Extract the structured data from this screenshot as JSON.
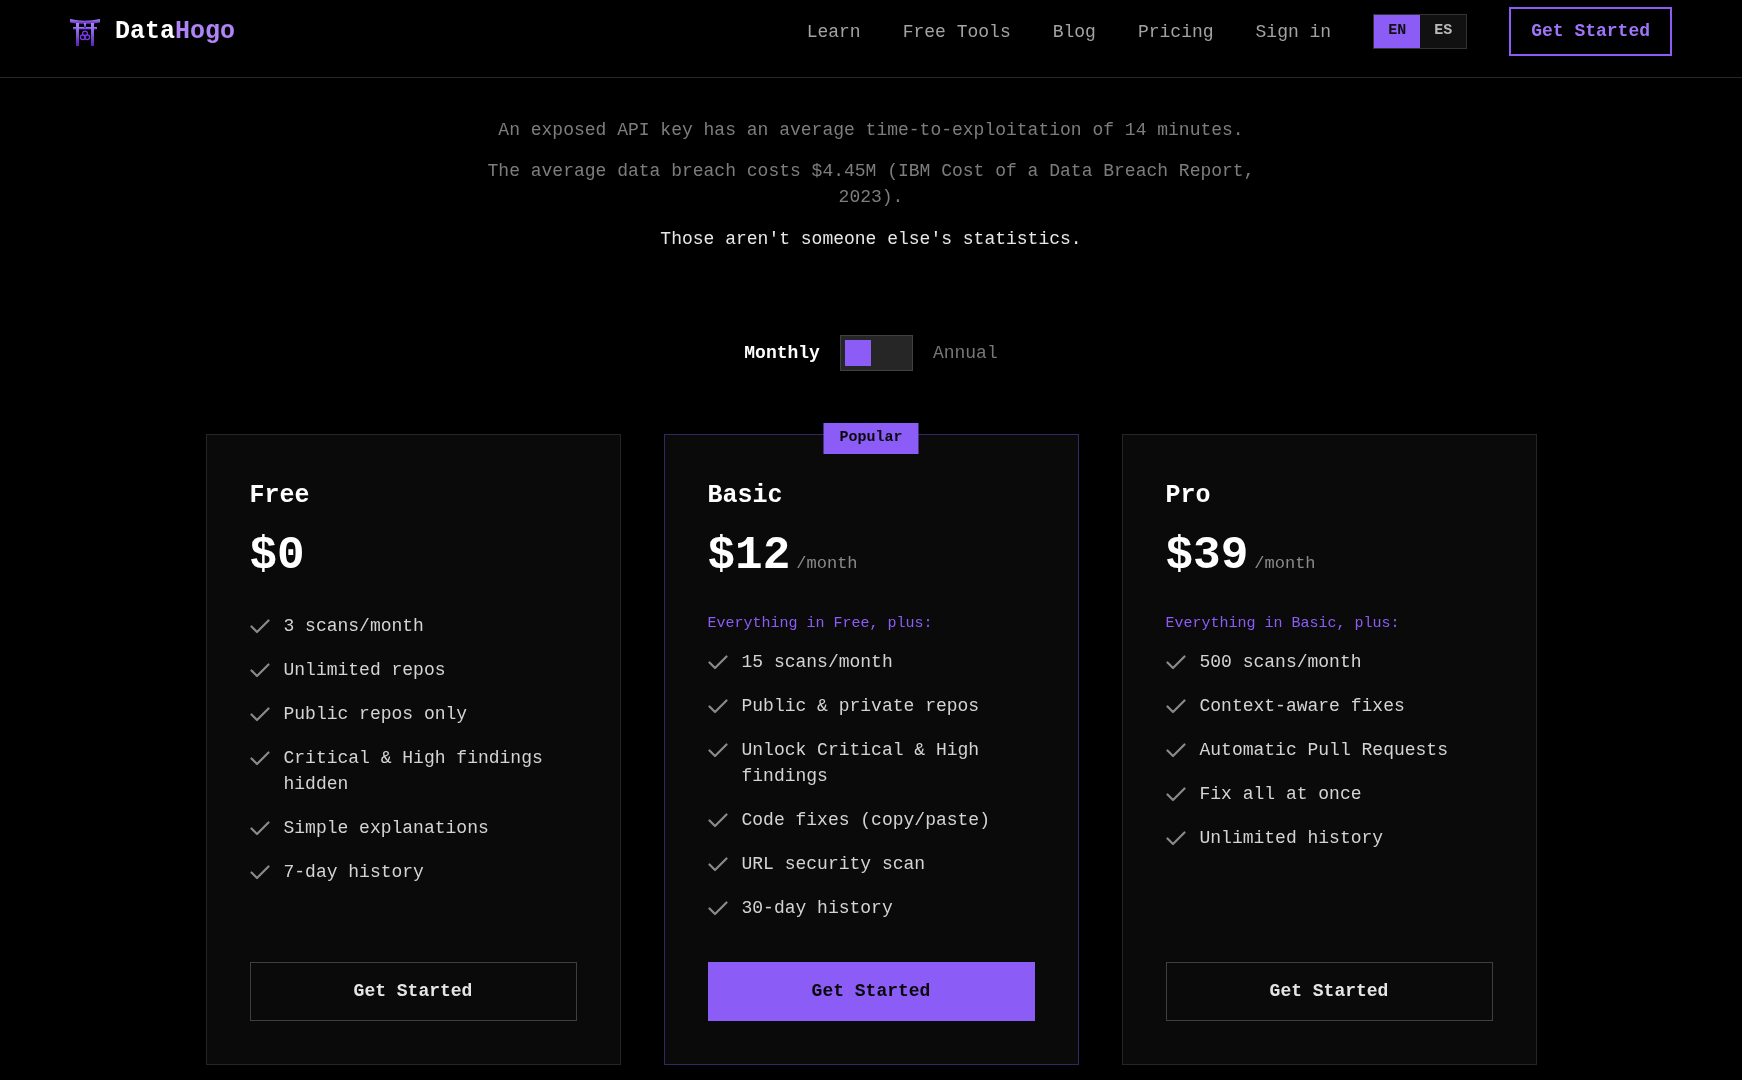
{
  "header": {
    "logo": {
      "text": "Data",
      "accent_text": "Hogo"
    },
    "nav": [
      {
        "label": "Learn"
      },
      {
        "label": "Free Tools"
      },
      {
        "label": "Blog"
      },
      {
        "label": "Pricing"
      },
      {
        "label": "Sign in"
      }
    ],
    "languages": [
      {
        "label": "EN",
        "selected": true
      },
      {
        "label": "ES",
        "selected": false
      }
    ],
    "cta": {
      "label": "Get Started"
    }
  },
  "intro": {
    "facts": [
      "An exposed API key has an average time-to-exploitation of 14 minutes.",
      "The average data breach costs $4.45M (IBM Cost of a Data Breach Report, 2023)."
    ],
    "closing": "Those aren't someone else's statistics."
  },
  "billing": {
    "options": [
      {
        "label": "Monthly",
        "selected": true
      },
      {
        "label": "Annual",
        "selected": false
      }
    ]
  },
  "plans": [
    {
      "name": "Free",
      "price": "$0",
      "featured": false,
      "features": [
        "3 scans/month",
        "Unlimited repos",
        "Public repos only",
        "Critical & High findings hidden",
        "Simple explanations",
        "7-day history"
      ],
      "button": "Get Started"
    },
    {
      "name": "Basic",
      "badge": "Popular",
      "price": "$12",
      "period": "/month",
      "includes": "Everything in Free, plus:",
      "featured": true,
      "features": [
        "15 scans/month",
        "Public & private repos",
        "Unlock Critical & High findings",
        "Code fixes (copy/paste)",
        "URL security scan",
        "30-day history"
      ],
      "button": "Get Started"
    },
    {
      "name": "Pro",
      "price": "$39",
      "period": "/month",
      "includes": "Everything in Basic, plus:",
      "featured": false,
      "features": [
        "500 scans/month",
        "Context-aware fixes",
        "Automatic Pull Requests",
        "Fix all at once",
        "Unlimited history"
      ],
      "button": "Get Started"
    }
  ]
}
